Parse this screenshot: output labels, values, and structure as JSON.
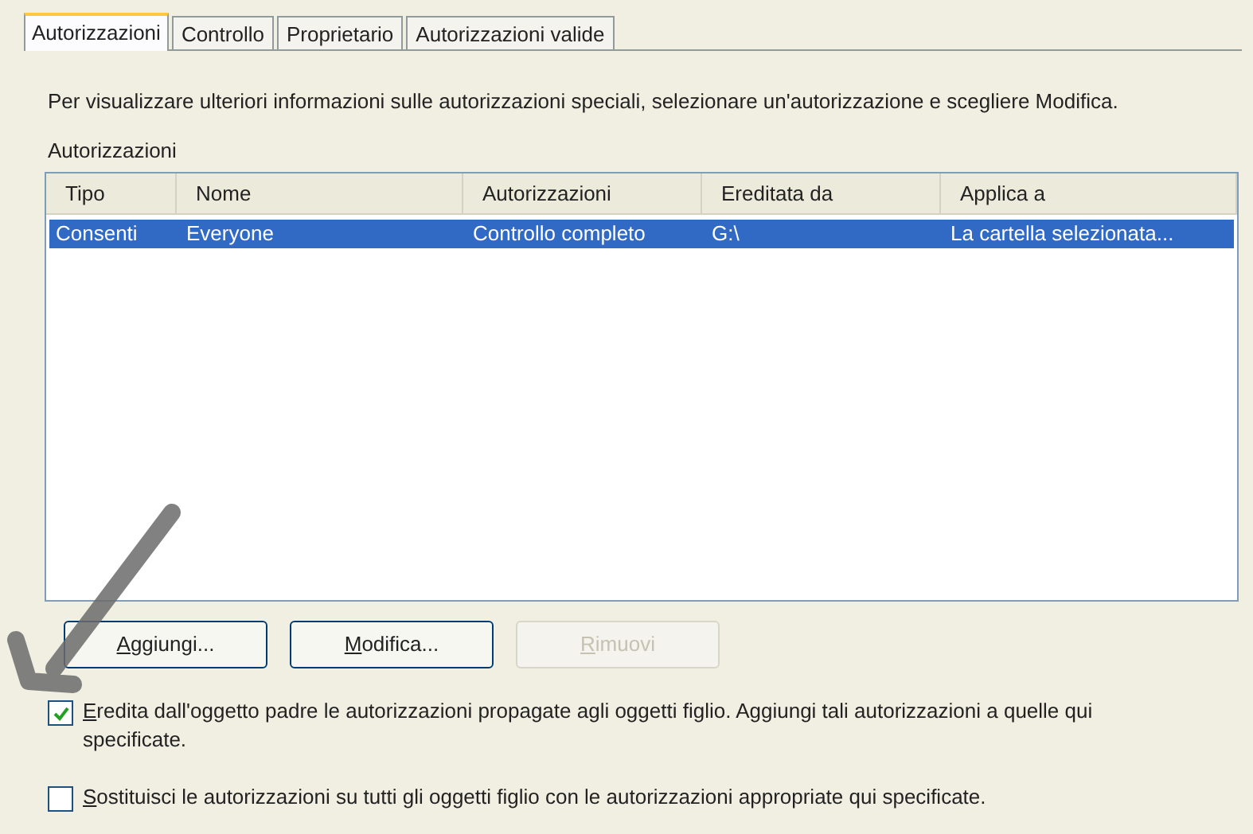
{
  "tabs": [
    {
      "label": "Autorizzazioni",
      "selected": true
    },
    {
      "label": "Controllo",
      "selected": false
    },
    {
      "label": "Proprietario",
      "selected": false
    },
    {
      "label": "Autorizzazioni valide",
      "selected": false
    }
  ],
  "intro": "Per visualizzare ulteriori informazioni sulle autorizzazioni speciali, selezionare un'autorizzazione e scegliere Modifica.",
  "list_label": "Autorizzazioni",
  "table": {
    "columns": [
      "Tipo",
      "Nome",
      "Autorizzazioni",
      "Ereditata da",
      "Applica a"
    ],
    "rows": [
      {
        "cells": [
          "Consenti",
          "Everyone",
          "Controllo completo",
          "G:\\",
          "La cartella selezionata..."
        ],
        "selected": true
      }
    ]
  },
  "buttons": [
    {
      "label": "Aggiungi...",
      "disabled": false
    },
    {
      "label": "Modifica...",
      "disabled": false
    },
    {
      "label": "Rimuovi",
      "disabled": true
    }
  ],
  "options": [
    {
      "label": "Eredita dall'oggetto padre le autorizzazioni propagate agli oggetti figlio. Aggiungi tali autorizzazioni a quelle qui specificate.",
      "checked": true
    },
    {
      "label": "Sostituisci le autorizzazioni su tutti gli oggetti figlio con le autorizzazioni appropriate qui specificate.",
      "checked": false
    }
  ]
}
